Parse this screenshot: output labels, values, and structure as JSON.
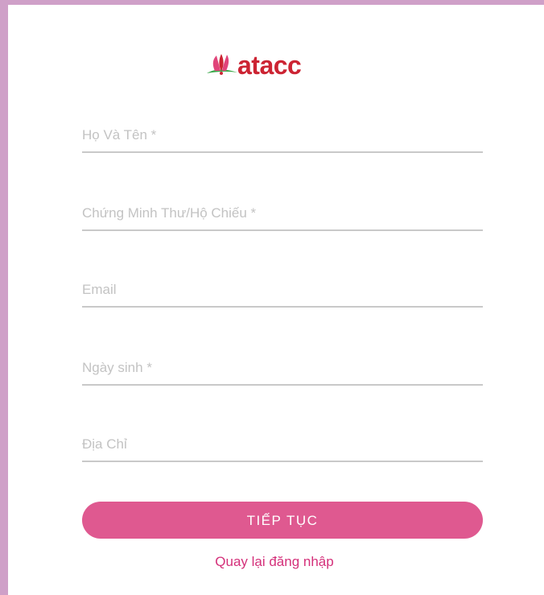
{
  "brand": {
    "logo_icon": "lotus-flower-icon",
    "logo_text": "atacc",
    "brand_color": "#cc2433"
  },
  "form": {
    "fields": [
      {
        "placeholder": "Họ Và Tên *"
      },
      {
        "placeholder": "Chứng Minh Thư/Hộ Chiếu *"
      },
      {
        "placeholder": "Email"
      },
      {
        "placeholder": "Ngày sinh *"
      },
      {
        "placeholder": "Địa Chỉ"
      }
    ],
    "submit_label": "TIẾP TỤC",
    "back_link_label": "Quay lại đăng nhập"
  },
  "colors": {
    "background": "#cfa0c8",
    "card": "#ffffff",
    "accent": "#df5990",
    "link": "#d4307a",
    "divider": "#c9c9c9"
  }
}
